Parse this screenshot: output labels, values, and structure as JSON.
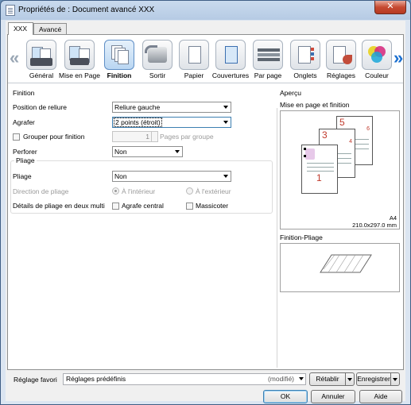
{
  "window": {
    "title": "Propriétés de : Document avancé XXX",
    "close_label": "✕"
  },
  "tabs": [
    {
      "label": "XXX"
    },
    {
      "label": "Avancé"
    }
  ],
  "ribbon": {
    "items": [
      {
        "label": "Général",
        "icon": "general-icon"
      },
      {
        "label": "Mise en Page",
        "icon": "layout-icon"
      },
      {
        "label": "Finition",
        "icon": "finishing-icon",
        "selected": true
      },
      {
        "label": "Sortir",
        "icon": "output-icon"
      },
      {
        "label": "Papier",
        "icon": "paper-icon"
      },
      {
        "label": "Couvertures",
        "icon": "covers-icon"
      },
      {
        "label": "Par page",
        "icon": "per-page-icon"
      },
      {
        "label": "Onglets",
        "icon": "tabs-icon"
      },
      {
        "label": "Réglages",
        "icon": "settings-icon"
      },
      {
        "label": "Couleur",
        "icon": "color-icon"
      }
    ],
    "left_arrow": "«",
    "right_arrow": "»"
  },
  "finition": {
    "group_label": "Finition",
    "position_reliure_label": "Position de reliure",
    "position_reliure_value": "Reliure gauche",
    "agrafer_label": "Agrafer",
    "agrafer_value": "2 points (étroit)",
    "grouper_label": "Grouper pour finition",
    "pages_par_groupe_value": "1",
    "pages_par_groupe_label": "Pages par groupe",
    "perforer_label": "Perforer",
    "perforer_value": "Non"
  },
  "pliage": {
    "group_label": "Pliage",
    "pliage_label": "Pliage",
    "pliage_value": "Non",
    "direction_label": "Direction de pliage",
    "interieur_label": "À l'intérieur",
    "exterieur_label": "À l'extérieur",
    "details_label": "Détails de pliage en deux multi",
    "agrafe_central_label": "Agrafe central",
    "massicoter_label": "Massicoter"
  },
  "apercu": {
    "group_label": "Aperçu",
    "mise_en_page_label": "Mise en page et finition",
    "paper_size": "A4",
    "paper_dims": "210.0x297.0 mm",
    "page_numbers": [
      "5",
      "6",
      "3",
      "4",
      "1"
    ],
    "finition_pliage_label": "Finition-Pliage"
  },
  "footer": {
    "reglage_favori_label": "Réglage favori",
    "reglage_value": "Réglages prédéfinis",
    "modified_label": "(modifié)",
    "retablir_label": "Rétablir",
    "enregistrer_label": "Enregistrer",
    "ok_label": "OK",
    "annuler_label": "Annuler",
    "aide_label": "Aide"
  }
}
